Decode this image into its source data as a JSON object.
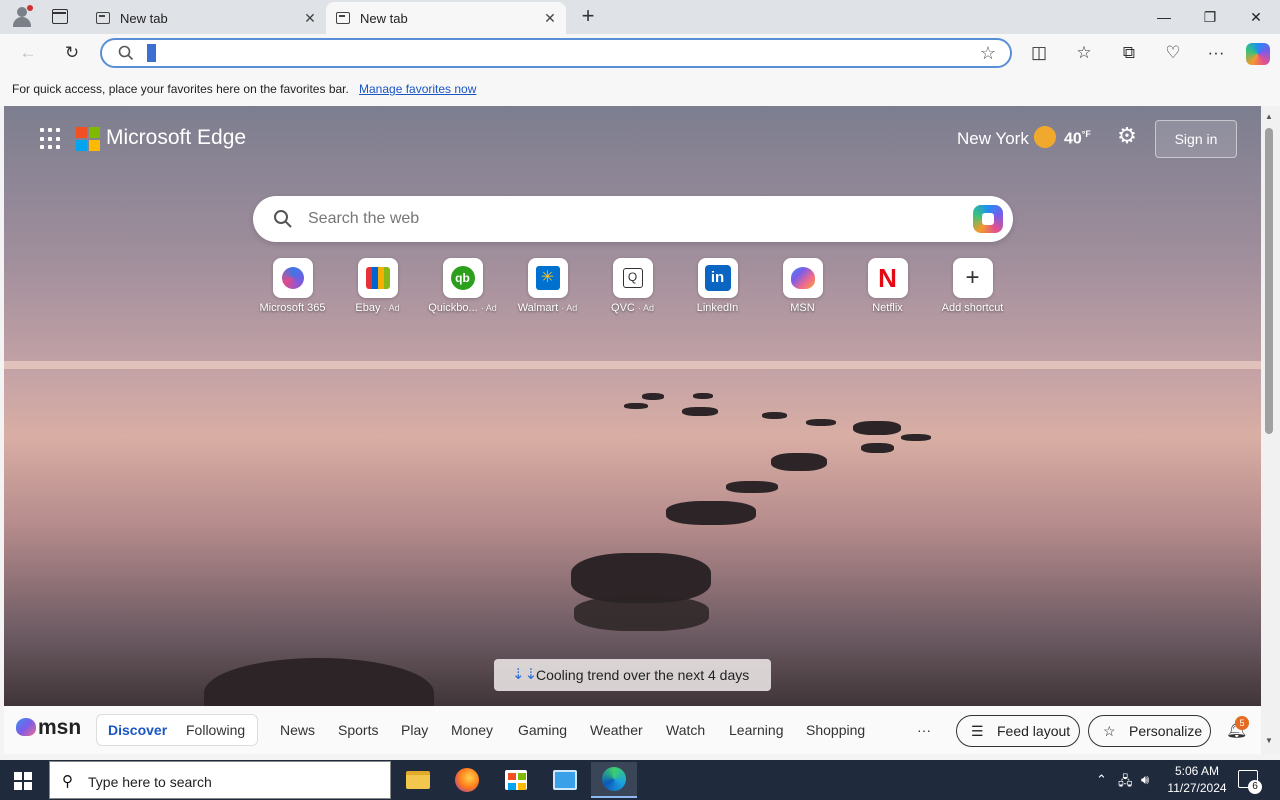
{
  "tabs": [
    {
      "title": "New tab",
      "active": false
    },
    {
      "title": "New tab",
      "active": true
    }
  ],
  "address_bar": {
    "value": ""
  },
  "favorites_bar": {
    "message": "For quick access, place your favorites here on the favorites bar.",
    "link": "Manage favorites now"
  },
  "header": {
    "brand": "Microsoft Edge",
    "city": "New York",
    "temperature": "40",
    "unit": "°F",
    "sign_in": "Sign in"
  },
  "web_search": {
    "placeholder": "Search the web"
  },
  "shortcuts": [
    {
      "label": "Microsoft 365",
      "ad": "",
      "icon": "microsoft365-icon"
    },
    {
      "label": "Ebay",
      "ad": "· Ad",
      "icon": "ebay-icon"
    },
    {
      "label": "Quickbo...",
      "ad": "· Ad",
      "icon": "quickbooks-icon"
    },
    {
      "label": "Walmart",
      "ad": "· Ad",
      "icon": "walmart-icon"
    },
    {
      "label": "QVC",
      "ad": "· Ad",
      "icon": "qvc-icon"
    },
    {
      "label": "LinkedIn",
      "ad": "",
      "icon": "linkedin-icon"
    },
    {
      "label": "MSN",
      "ad": "",
      "icon": "msn-icon"
    },
    {
      "label": "Netflix",
      "ad": "",
      "icon": "netflix-icon"
    },
    {
      "label": "Add shortcut",
      "ad": "",
      "icon": "plus-icon"
    }
  ],
  "weather_trend": {
    "text": "Cooling trend over the next 4 days"
  },
  "msn_bar": {
    "logo": "msn",
    "segments": {
      "discover": "Discover",
      "following": "Following"
    },
    "nav": [
      "News",
      "Sports",
      "Play",
      "Money",
      "Gaming",
      "Weather",
      "Watch",
      "Learning",
      "Shopping"
    ],
    "more": "···",
    "feed_layout": "Feed layout",
    "personalize": "Personalize",
    "notification_count": "5"
  },
  "taskbar": {
    "search_placeholder": "Type here to search",
    "time": "5:06 AM",
    "date": "11/27/2024",
    "notifications": "6"
  },
  "colors": {
    "accent": "#1a56c4",
    "discover_active": "#1a56c4",
    "badge": "#e66a1f"
  }
}
